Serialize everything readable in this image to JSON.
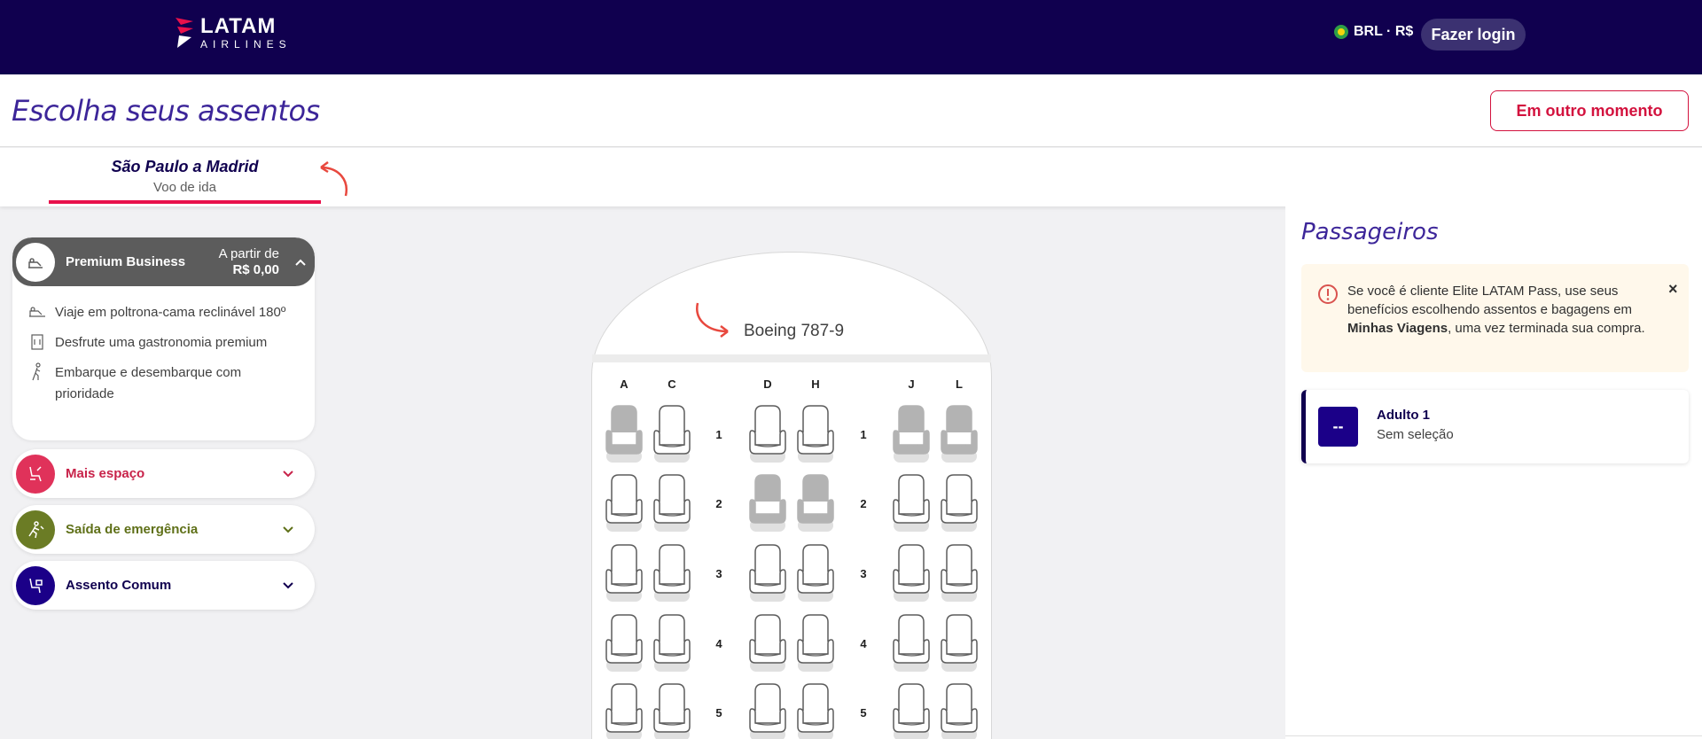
{
  "header": {
    "logo_brand": "LATAM",
    "logo_sub": "AIRLINES",
    "currency": "BRL · R$",
    "login_label": "Fazer login"
  },
  "titlebar": {
    "title": "Escolha seus assentos",
    "later_label": "Em outro momento"
  },
  "route": {
    "title": "São Paulo a Madrid",
    "subtitle": "Voo de ida"
  },
  "categories": {
    "open": {
      "name": "Premium Business",
      "price_prefix": "A partir de",
      "price": "R$ 0,00",
      "benefits": [
        {
          "icon": "seat-bed-icon",
          "text": "Viaje em poltrona-cama reclinável 180º"
        },
        {
          "icon": "menu-icon",
          "text": "Desfrute uma gastronomia premium"
        },
        {
          "icon": "walking-person-icon",
          "text": "Embarque e desembarque com prioridade"
        }
      ]
    },
    "items": [
      {
        "name": "Mais espaço",
        "color": "#e0325a",
        "text_color": "#c8234a",
        "icon": "legroom-seat-icon"
      },
      {
        "name": "Saída de emergência",
        "color": "#6b7c25",
        "text_color": "#5f7018",
        "icon": "emergency-exit-icon"
      },
      {
        "name": "Assento Comum",
        "color": "#1b0088",
        "text_color": "#10004f",
        "icon": "standard-seat-icon"
      }
    ]
  },
  "seatmap": {
    "aircraft": "Boeing 787-9",
    "columns": [
      "A",
      "C",
      "D",
      "H",
      "J",
      "L"
    ],
    "rows": [
      "1",
      "2",
      "3",
      "4",
      "5"
    ]
  },
  "passengers": {
    "title": "Passageiros",
    "alert": {
      "text_before": "Se você é cliente Elite LATAM Pass, use seus benefícios escolhendo assentos e bagagens em ",
      "text_bold": "Minhas Viagens",
      "text_after": ", uma vez terminada sua compra.",
      "close": "×"
    },
    "list": [
      {
        "seat": "--",
        "name": "Adulto 1",
        "status": "Sem seleção"
      }
    ]
  },
  "colors": {
    "navy": "#10004f",
    "accent": "#e8114b",
    "occupied_seat": "#b3b3b3"
  }
}
